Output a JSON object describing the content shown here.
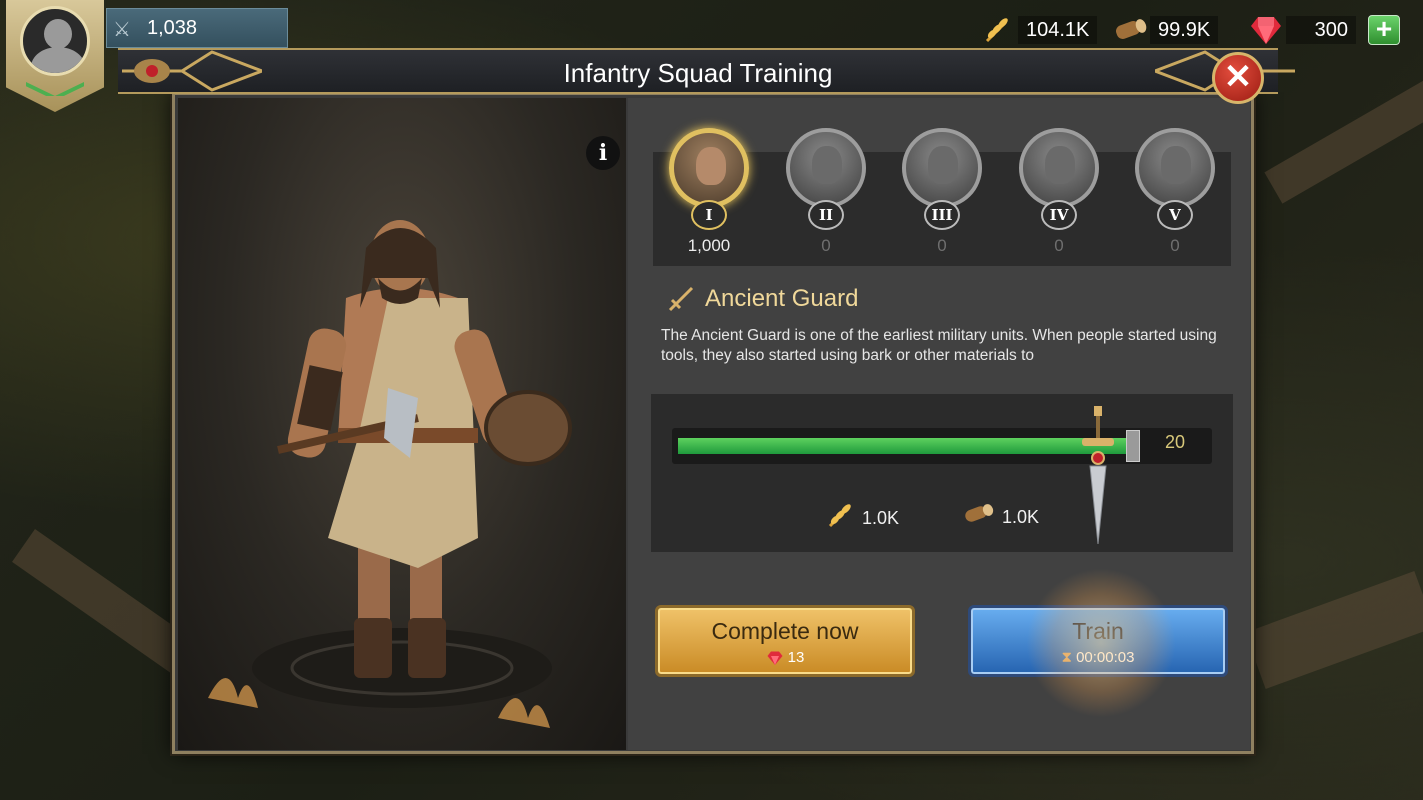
{
  "profile": {
    "power": "1,038"
  },
  "resources": {
    "food": {
      "icon": "wheat-icon",
      "value": "104.1K"
    },
    "wood": {
      "icon": "log-icon",
      "value": "99.9K"
    },
    "gems": {
      "icon": "ruby-icon",
      "value": "300"
    },
    "add_label": "+"
  },
  "dialog": {
    "title": "Infantry Squad Training",
    "close_label": "✕",
    "info_label": "i"
  },
  "tiers": [
    {
      "numeral": "I",
      "count": "1,000",
      "selected": true
    },
    {
      "numeral": "II",
      "count": "0",
      "selected": false
    },
    {
      "numeral": "III",
      "count": "0",
      "selected": false
    },
    {
      "numeral": "IV",
      "count": "0",
      "selected": false
    },
    {
      "numeral": "V",
      "count": "0",
      "selected": false
    }
  ],
  "unit": {
    "name": "Ancient Guard",
    "description": "The Ancient Guard is one of the earliest military units. When people started using tools, they also started using bark or other materials to"
  },
  "training": {
    "quantity": "20",
    "slider_fraction": 0.98,
    "cost_food": "1.0K",
    "cost_wood": "1.0K"
  },
  "actions": {
    "complete_label": "Complete now",
    "complete_cost": "13",
    "train_label": "Train",
    "train_time": "00:00:03"
  },
  "colors": {
    "accent_gold": "#e0c060",
    "slider_green": "#3fbf4f",
    "complete_button": "#e0ac48",
    "train_button": "#3f86d2"
  }
}
